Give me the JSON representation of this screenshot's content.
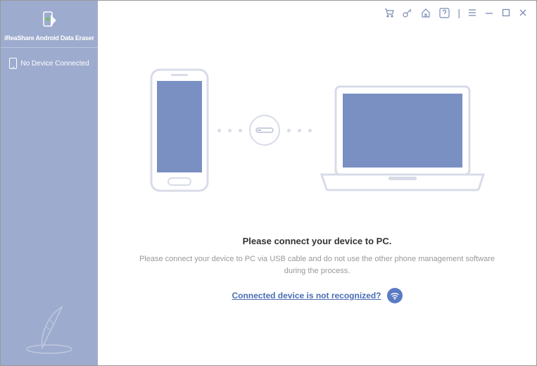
{
  "app": {
    "title": "iReaShare Android Data Eraser"
  },
  "sidebar": {
    "device_status": "No Device Connected"
  },
  "main": {
    "heading": "Please connect your device to PC.",
    "subtext": "Please connect your device to PC via USB cable and do not use the other phone management software during the process.",
    "help_link": "Connected device is not recognized?"
  },
  "titlebar": {
    "icons": [
      "cart",
      "key",
      "home",
      "help",
      "menu",
      "minimize",
      "maximize",
      "close"
    ]
  },
  "colors": {
    "sidebar": "#9dabce",
    "accent": "#5a7bc4",
    "device_fill": "#7a8fc2",
    "outline": "#d8dce8"
  }
}
